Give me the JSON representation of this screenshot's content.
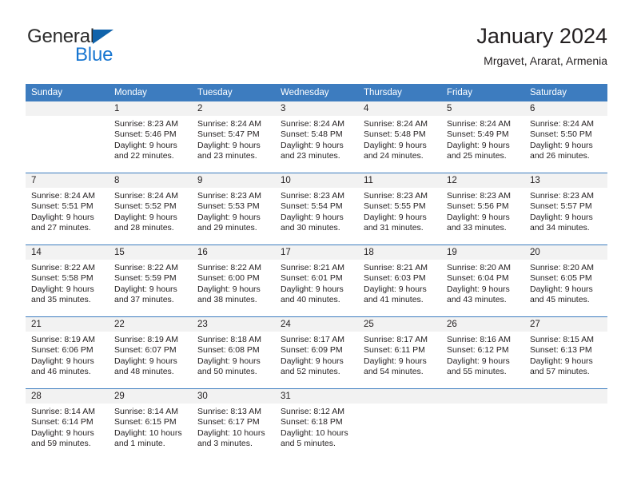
{
  "brand": {
    "name_part1": "General",
    "name_part2": "Blue",
    "triangle_icon": "brand-triangle-icon",
    "color_primary": "#1063ab",
    "color_secondary": "#1876d1"
  },
  "header": {
    "title": "January 2024",
    "subtitle": "Mrgavet, Ararat, Armenia"
  },
  "theme": {
    "header_blue": "#3d7cbf",
    "daynum_gray": "#f2f2f2",
    "text": "#231f20"
  },
  "weekday_headers": [
    "Sunday",
    "Monday",
    "Tuesday",
    "Wednesday",
    "Thursday",
    "Friday",
    "Saturday"
  ],
  "weeks": [
    [
      {
        "day": "",
        "empty": true,
        "sunrise": "",
        "sunset": "",
        "daylight": ""
      },
      {
        "day": "1",
        "sunrise": "Sunrise: 8:23 AM",
        "sunset": "Sunset: 5:46 PM",
        "daylight": "Daylight: 9 hours and 22 minutes."
      },
      {
        "day": "2",
        "sunrise": "Sunrise: 8:24 AM",
        "sunset": "Sunset: 5:47 PM",
        "daylight": "Daylight: 9 hours and 23 minutes."
      },
      {
        "day": "3",
        "sunrise": "Sunrise: 8:24 AM",
        "sunset": "Sunset: 5:48 PM",
        "daylight": "Daylight: 9 hours and 23 minutes."
      },
      {
        "day": "4",
        "sunrise": "Sunrise: 8:24 AM",
        "sunset": "Sunset: 5:48 PM",
        "daylight": "Daylight: 9 hours and 24 minutes."
      },
      {
        "day": "5",
        "sunrise": "Sunrise: 8:24 AM",
        "sunset": "Sunset: 5:49 PM",
        "daylight": "Daylight: 9 hours and 25 minutes."
      },
      {
        "day": "6",
        "sunrise": "Sunrise: 8:24 AM",
        "sunset": "Sunset: 5:50 PM",
        "daylight": "Daylight: 9 hours and 26 minutes."
      }
    ],
    [
      {
        "day": "7",
        "sunrise": "Sunrise: 8:24 AM",
        "sunset": "Sunset: 5:51 PM",
        "daylight": "Daylight: 9 hours and 27 minutes."
      },
      {
        "day": "8",
        "sunrise": "Sunrise: 8:24 AM",
        "sunset": "Sunset: 5:52 PM",
        "daylight": "Daylight: 9 hours and 28 minutes."
      },
      {
        "day": "9",
        "sunrise": "Sunrise: 8:23 AM",
        "sunset": "Sunset: 5:53 PM",
        "daylight": "Daylight: 9 hours and 29 minutes."
      },
      {
        "day": "10",
        "sunrise": "Sunrise: 8:23 AM",
        "sunset": "Sunset: 5:54 PM",
        "daylight": "Daylight: 9 hours and 30 minutes."
      },
      {
        "day": "11",
        "sunrise": "Sunrise: 8:23 AM",
        "sunset": "Sunset: 5:55 PM",
        "daylight": "Daylight: 9 hours and 31 minutes."
      },
      {
        "day": "12",
        "sunrise": "Sunrise: 8:23 AM",
        "sunset": "Sunset: 5:56 PM",
        "daylight": "Daylight: 9 hours and 33 minutes."
      },
      {
        "day": "13",
        "sunrise": "Sunrise: 8:23 AM",
        "sunset": "Sunset: 5:57 PM",
        "daylight": "Daylight: 9 hours and 34 minutes."
      }
    ],
    [
      {
        "day": "14",
        "sunrise": "Sunrise: 8:22 AM",
        "sunset": "Sunset: 5:58 PM",
        "daylight": "Daylight: 9 hours and 35 minutes."
      },
      {
        "day": "15",
        "sunrise": "Sunrise: 8:22 AM",
        "sunset": "Sunset: 5:59 PM",
        "daylight": "Daylight: 9 hours and 37 minutes."
      },
      {
        "day": "16",
        "sunrise": "Sunrise: 8:22 AM",
        "sunset": "Sunset: 6:00 PM",
        "daylight": "Daylight: 9 hours and 38 minutes."
      },
      {
        "day": "17",
        "sunrise": "Sunrise: 8:21 AM",
        "sunset": "Sunset: 6:01 PM",
        "daylight": "Daylight: 9 hours and 40 minutes."
      },
      {
        "day": "18",
        "sunrise": "Sunrise: 8:21 AM",
        "sunset": "Sunset: 6:03 PM",
        "daylight": "Daylight: 9 hours and 41 minutes."
      },
      {
        "day": "19",
        "sunrise": "Sunrise: 8:20 AM",
        "sunset": "Sunset: 6:04 PM",
        "daylight": "Daylight: 9 hours and 43 minutes."
      },
      {
        "day": "20",
        "sunrise": "Sunrise: 8:20 AM",
        "sunset": "Sunset: 6:05 PM",
        "daylight": "Daylight: 9 hours and 45 minutes."
      }
    ],
    [
      {
        "day": "21",
        "sunrise": "Sunrise: 8:19 AM",
        "sunset": "Sunset: 6:06 PM",
        "daylight": "Daylight: 9 hours and 46 minutes."
      },
      {
        "day": "22",
        "sunrise": "Sunrise: 8:19 AM",
        "sunset": "Sunset: 6:07 PM",
        "daylight": "Daylight: 9 hours and 48 minutes."
      },
      {
        "day": "23",
        "sunrise": "Sunrise: 8:18 AM",
        "sunset": "Sunset: 6:08 PM",
        "daylight": "Daylight: 9 hours and 50 minutes."
      },
      {
        "day": "24",
        "sunrise": "Sunrise: 8:17 AM",
        "sunset": "Sunset: 6:09 PM",
        "daylight": "Daylight: 9 hours and 52 minutes."
      },
      {
        "day": "25",
        "sunrise": "Sunrise: 8:17 AM",
        "sunset": "Sunset: 6:11 PM",
        "daylight": "Daylight: 9 hours and 54 minutes."
      },
      {
        "day": "26",
        "sunrise": "Sunrise: 8:16 AM",
        "sunset": "Sunset: 6:12 PM",
        "daylight": "Daylight: 9 hours and 55 minutes."
      },
      {
        "day": "27",
        "sunrise": "Sunrise: 8:15 AM",
        "sunset": "Sunset: 6:13 PM",
        "daylight": "Daylight: 9 hours and 57 minutes."
      }
    ],
    [
      {
        "day": "28",
        "sunrise": "Sunrise: 8:14 AM",
        "sunset": "Sunset: 6:14 PM",
        "daylight": "Daylight: 9 hours and 59 minutes."
      },
      {
        "day": "29",
        "sunrise": "Sunrise: 8:14 AM",
        "sunset": "Sunset: 6:15 PM",
        "daylight": "Daylight: 10 hours and 1 minute."
      },
      {
        "day": "30",
        "sunrise": "Sunrise: 8:13 AM",
        "sunset": "Sunset: 6:17 PM",
        "daylight": "Daylight: 10 hours and 3 minutes."
      },
      {
        "day": "31",
        "sunrise": "Sunrise: 8:12 AM",
        "sunset": "Sunset: 6:18 PM",
        "daylight": "Daylight: 10 hours and 5 minutes."
      },
      {
        "day": "",
        "empty": true,
        "sunrise": "",
        "sunset": "",
        "daylight": ""
      },
      {
        "day": "",
        "empty": true,
        "sunrise": "",
        "sunset": "",
        "daylight": ""
      },
      {
        "day": "",
        "empty": true,
        "sunrise": "",
        "sunset": "",
        "daylight": ""
      }
    ]
  ]
}
